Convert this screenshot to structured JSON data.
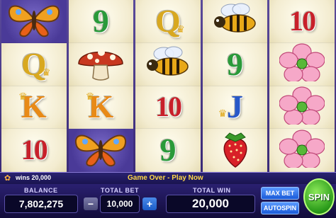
{
  "reels": [
    [
      {
        "symbol": "butterfly-icon",
        "bg": "dark"
      },
      {
        "symbol": "Q",
        "bg": "light"
      },
      {
        "symbol": "K",
        "bg": "light"
      },
      {
        "symbol": "10",
        "bg": "light"
      }
    ],
    [
      {
        "symbol": "9",
        "bg": "light"
      },
      {
        "symbol": "mushroom-icon",
        "bg": "light"
      },
      {
        "symbol": "K",
        "bg": "light"
      },
      {
        "symbol": "butterfly-icon",
        "bg": "dark"
      }
    ],
    [
      {
        "symbol": "Q",
        "bg": "light"
      },
      {
        "symbol": "bee-icon",
        "bg": "light"
      },
      {
        "symbol": "10",
        "bg": "light"
      },
      {
        "symbol": "9",
        "bg": "light"
      }
    ],
    [
      {
        "symbol": "bee-icon",
        "bg": "light"
      },
      {
        "symbol": "9",
        "bg": "light"
      },
      {
        "symbol": "J",
        "bg": "light"
      },
      {
        "symbol": "strawberry-icon",
        "bg": "light"
      }
    ],
    [
      {
        "symbol": "10",
        "bg": "light"
      },
      {
        "symbol": "flower-icon",
        "bg": "light"
      },
      {
        "symbol": "flower-icon",
        "bg": "light"
      },
      {
        "symbol": "flower-icon",
        "bg": "light"
      }
    ]
  ],
  "status": {
    "wins_text": "wins 20,000",
    "game_over_text": "Game Over - Play Now"
  },
  "panel": {
    "balance_label": "BALANCE",
    "balance_value": "7,802,275",
    "total_bet_label": "TOTAL BET",
    "total_bet_value": "10,000",
    "total_win_label": "TOTAL WIN",
    "total_win_value": "20,000",
    "minus_label": "−",
    "plus_label": "+",
    "max_bet_label": "MAX BET",
    "autospin_label": "AUTOSPIN",
    "spin_label": "SPIN"
  }
}
